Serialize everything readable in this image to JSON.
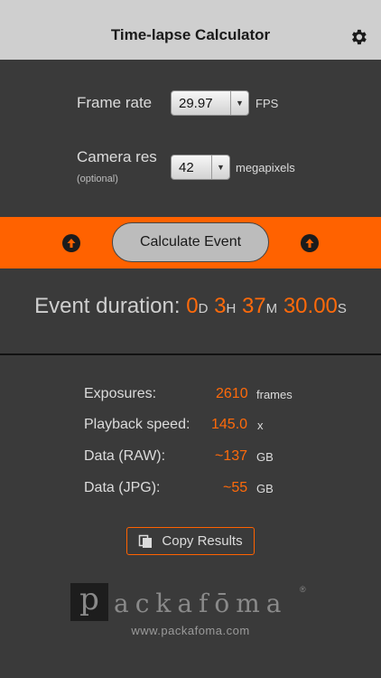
{
  "header": {
    "title": "Time-lapse Calculator"
  },
  "settings": {
    "frame_rate": {
      "label": "Frame rate",
      "value": "29.97",
      "unit": "FPS"
    },
    "camera_res": {
      "label": "Camera res",
      "sublabel": "(optional)",
      "value": "42",
      "unit": "megapixels"
    }
  },
  "action": {
    "calculate_label": "Calculate Event"
  },
  "duration": {
    "label": "Event duration:",
    "days": "0",
    "days_unit": "D",
    "hours": "3",
    "hours_unit": "H",
    "minutes": "37",
    "minutes_unit": "M",
    "seconds": "30.00",
    "seconds_unit": "S"
  },
  "results": {
    "exposures": {
      "label": "Exposures:",
      "value": "2610",
      "unit": "frames"
    },
    "playback": {
      "label": "Playback speed:",
      "value": "145.0",
      "unit": "x"
    },
    "raw": {
      "label": "Data (RAW):",
      "value": "~137",
      "unit": "GB"
    },
    "jpg": {
      "label": "Data (JPG):",
      "value": "~55",
      "unit": "GB"
    }
  },
  "copy": {
    "label": "Copy Results"
  },
  "brand": {
    "logo_initial": "p",
    "logo_rest": "ackafōma",
    "registered": "®",
    "website": "www.packafoma.com"
  },
  "colors": {
    "accent": "#ff6200",
    "background": "#3a3a3a",
    "header": "#cfcfcf"
  }
}
